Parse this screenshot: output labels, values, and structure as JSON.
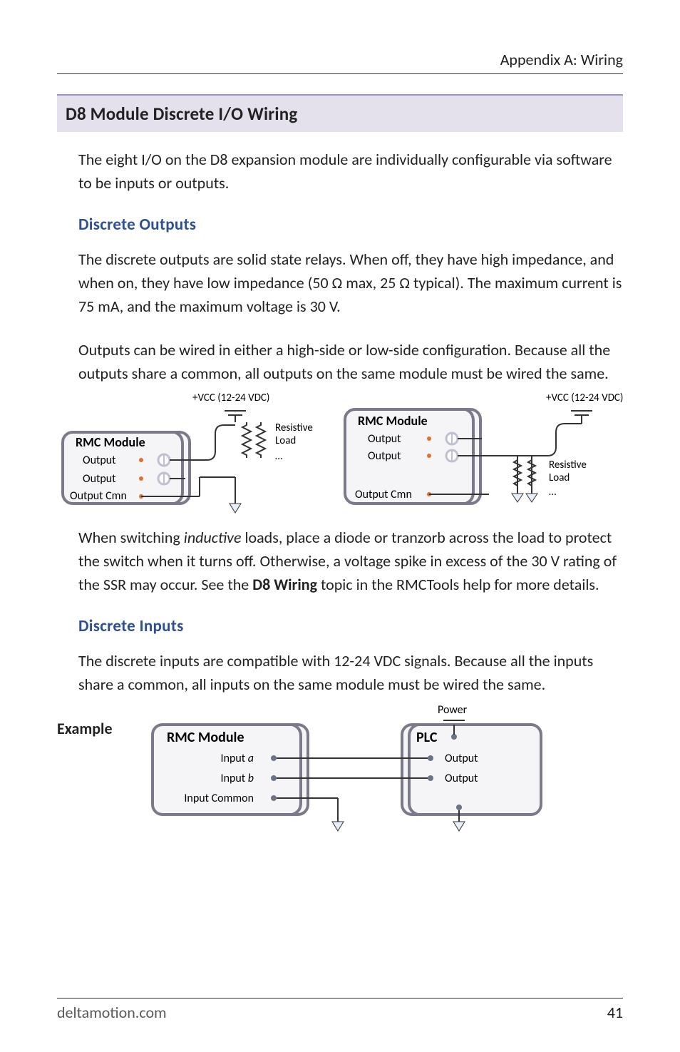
{
  "header": {
    "right": "Appendix A: Wiring"
  },
  "section": {
    "title": "D8 Module Discrete I/O Wiring"
  },
  "intro": "The eight I/O on the D8 expansion module are individually configurable via software to be inputs or outputs.",
  "outputs": {
    "heading": "Discrete Outputs",
    "p1": "The discrete outputs are solid state relays. When off, they have high impedance, and when on, they have low impedance (50 Ω max, 25 Ω typical). The maximum current is 75 mA, and the maximum voltage is 30 V.",
    "p2": "Outputs can be wired in either a high-side or low-side configuration. Because all the outputs share a common, all outputs on the same module must be wired the same.",
    "diagram": {
      "vcc": "+VCC (12-24 VDC)",
      "module": "RMC Module",
      "output": "Output",
      "output_cmn": "Output Cmn",
      "load1": "Resistive",
      "load2": "Load",
      "ellipsis": "…"
    },
    "p3a": "When switching ",
    "p3_ital": "inductive",
    "p3b": " loads, place a diode or tranzorb across the load to protect the switch when it turns off. Otherwise, a voltage spike in excess of the 30 V rating of the SSR may occur. See the ",
    "p3_bold": "D8 Wiring",
    "p3c": " topic in the RMCTools help for more details."
  },
  "inputs": {
    "heading": "Discrete Inputs",
    "p1": "The discrete inputs are compatible with 12-24 VDC signals. Because all the inputs share a common, all inputs on the same module must be wired the same.",
    "example_label": "Example",
    "diagram": {
      "module": "RMC Module",
      "input_a": "Input a",
      "input_b": "Input b",
      "input_cmn": "Input Common",
      "plc": "PLC",
      "output": "Output",
      "power": "Power"
    }
  },
  "footer": {
    "url": "deltamotion.com",
    "page": "41"
  }
}
